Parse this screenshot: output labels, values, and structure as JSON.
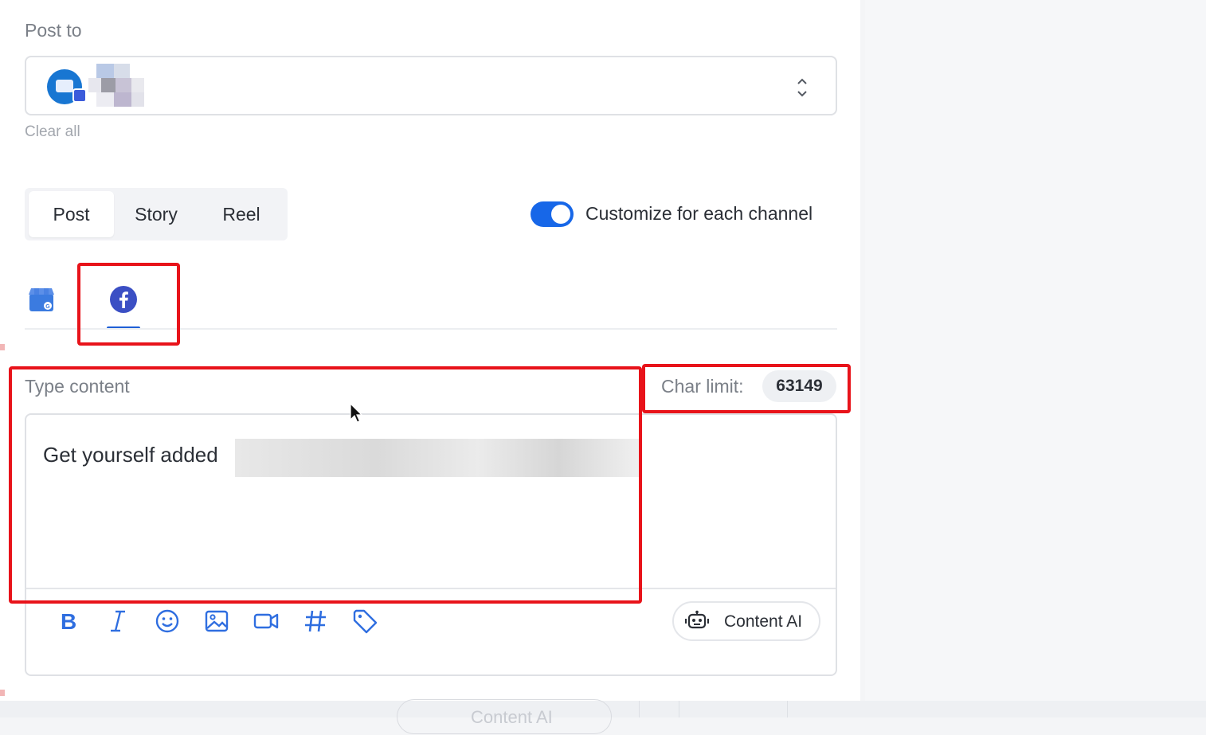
{
  "post_to": {
    "label": "Post to",
    "clear_label": "Clear all"
  },
  "post_type_tabs": [
    {
      "label": "Post",
      "active": true
    },
    {
      "label": "Story",
      "active": false
    },
    {
      "label": "Reel",
      "active": false
    }
  ],
  "customize": {
    "label": "Customize for each channel",
    "enabled": true
  },
  "channels": [
    {
      "icon": "google-business-icon",
      "active": false
    },
    {
      "icon": "facebook-icon",
      "active": true
    }
  ],
  "editor": {
    "label": "Type content",
    "char_limit_label": "Char limit:",
    "char_limit_value": "63149",
    "content": "Get yourself added",
    "toolbar": [
      "bold-icon",
      "italic-icon",
      "emoji-icon",
      "image-icon",
      "video-icon",
      "hashtag-icon",
      "tag-icon"
    ],
    "ai_button_label": "Content AI"
  },
  "bottom_ghost": {
    "label": "Content AI"
  },
  "colors": {
    "accent": "#1767e8",
    "highlight": "#e8131a",
    "facebook": "#3b4fc4"
  }
}
